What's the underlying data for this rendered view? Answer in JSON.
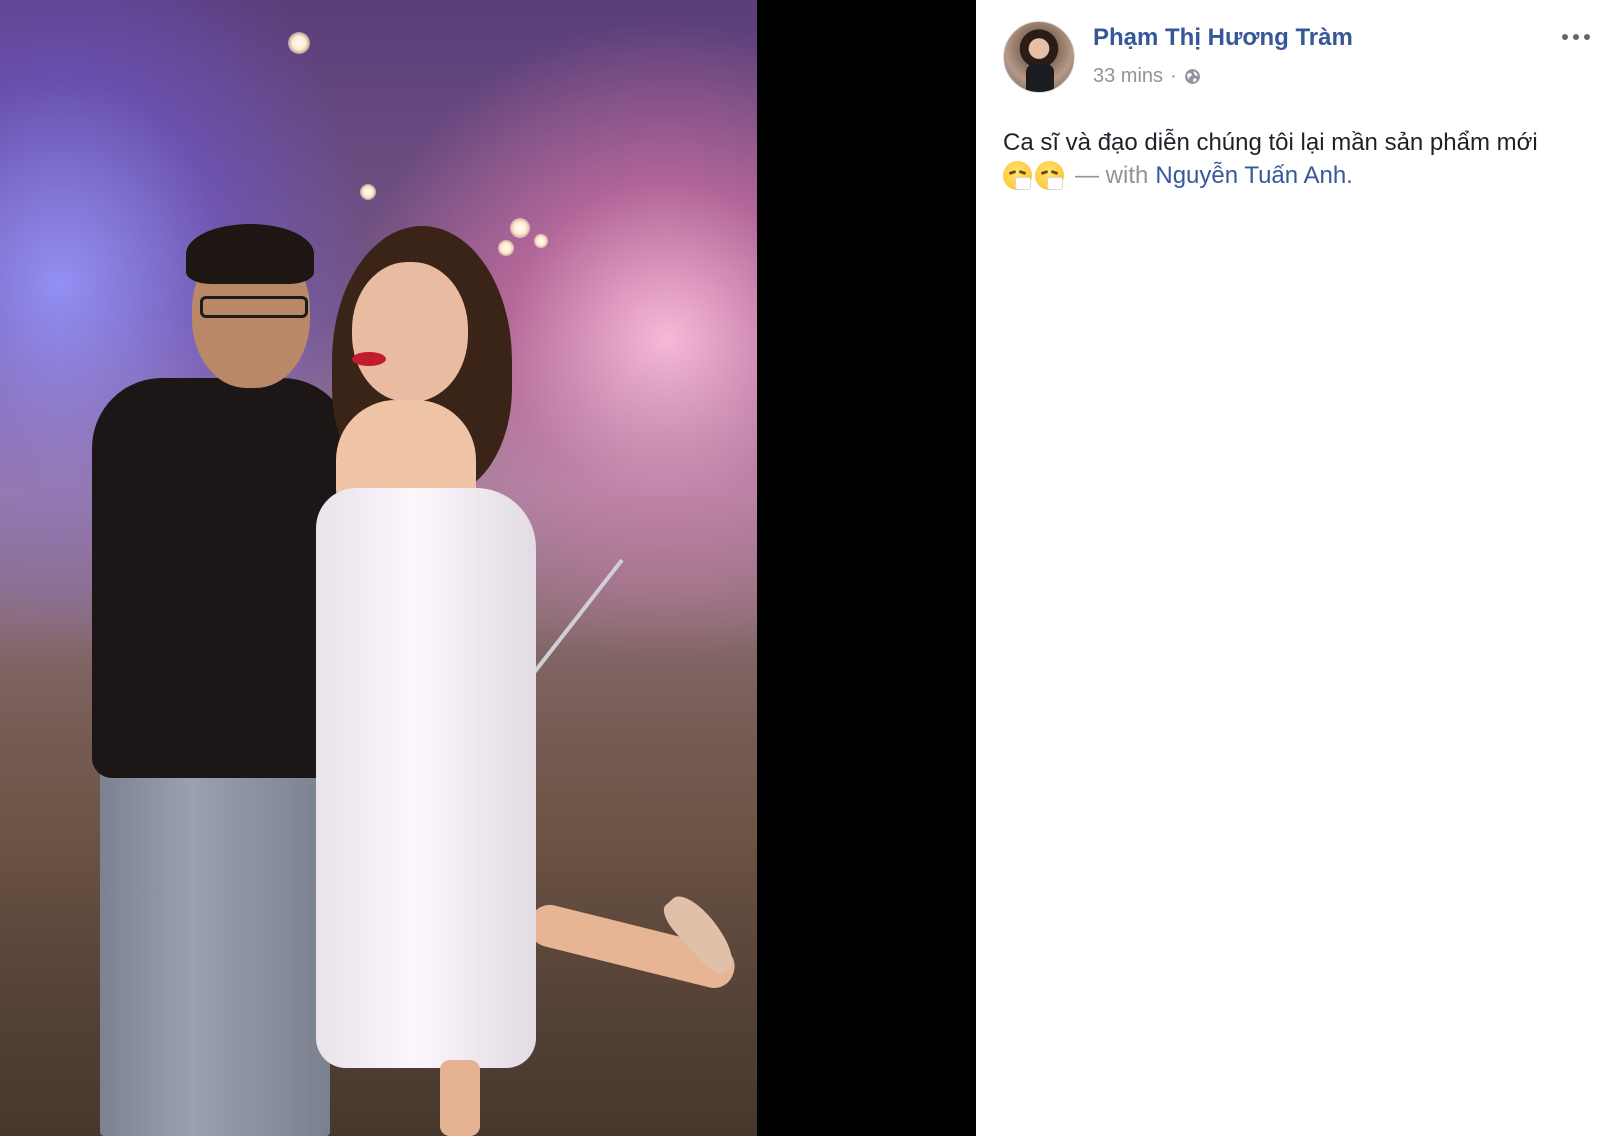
{
  "photo": {
    "alt_subject": "photo"
  },
  "post": {
    "author_name": "Phạm Thị Hương Tràm",
    "timestamp": "33 mins",
    "meta_separator": "·",
    "privacy_icon": "globe-icon",
    "message_line1": "Ca sĩ và đạo diễn chúng tôi lại mần sản phẩm mới",
    "emojis": [
      "sneezing-face-icon",
      "sneezing-face-icon"
    ],
    "with_text": "— with",
    "tagged_person": "Nguyễn Tuấn Anh.",
    "more_icon": "ellipsis-icon"
  },
  "colors": {
    "link_blue": "#365899",
    "meta_gray": "#90949c",
    "text_dark": "#1d2129",
    "stage_black": "#000000"
  }
}
